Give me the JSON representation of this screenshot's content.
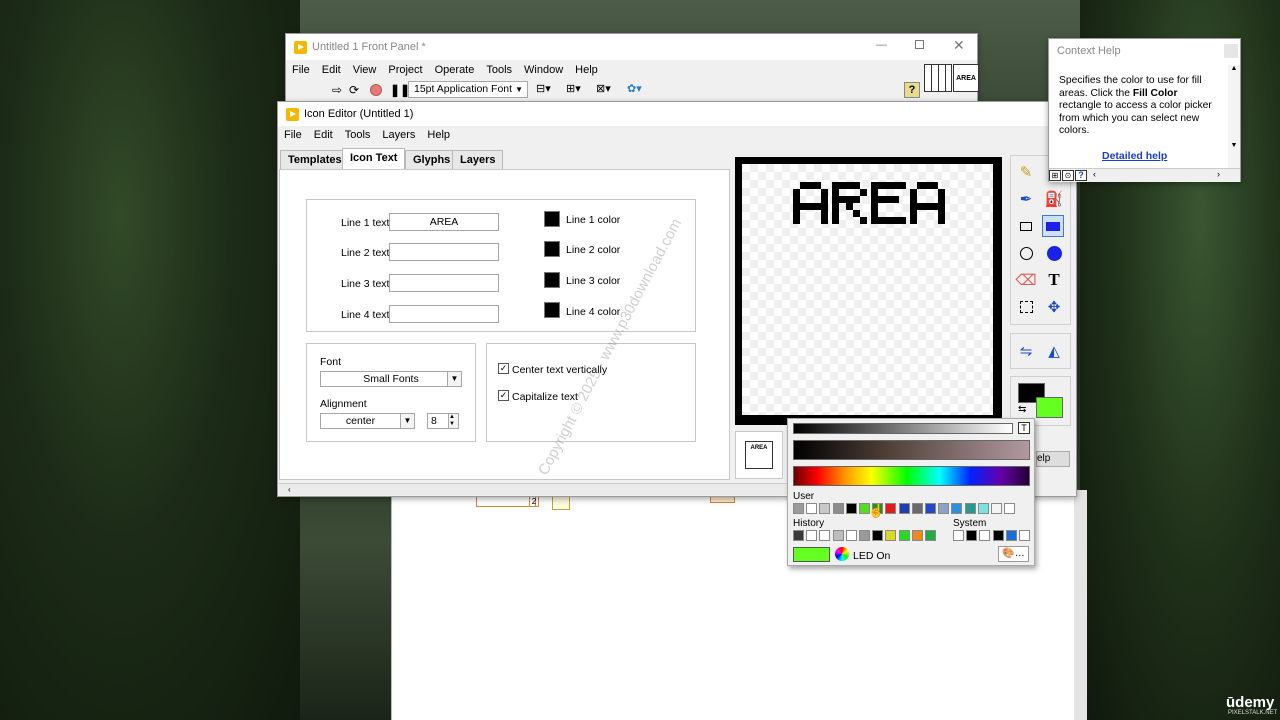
{
  "front_panel": {
    "title": "Untitled 1 Front Panel *",
    "menu": [
      "File",
      "Edit",
      "View",
      "Project",
      "Operate",
      "Tools",
      "Window",
      "Help"
    ],
    "font_select": "15pt Application Font",
    "icon_text": "AREA"
  },
  "icon_editor": {
    "title": "Icon Editor (Untitled 1)",
    "menu": [
      "File",
      "Edit",
      "Tools",
      "Layers",
      "Help"
    ],
    "tabs": [
      "Templates",
      "Icon Text",
      "Glyphs",
      "Layers"
    ],
    "active_tab": "Icon Text",
    "lines": [
      {
        "label": "Line 1 text",
        "value": "AREA",
        "color_label": "Line 1 color"
      },
      {
        "label": "Line 2 text",
        "value": "",
        "color_label": "Line 2 color"
      },
      {
        "label": "Line 3 text",
        "value": "",
        "color_label": "Line 3 color"
      },
      {
        "label": "Line 4 text",
        "value": "",
        "color_label": "Line 4 color"
      }
    ],
    "font_label": "Font",
    "font_value": "Small Fonts",
    "alignment_label": "Alignment",
    "alignment_value": "center",
    "size_value": "8",
    "center_vertically_label": "Center text vertically",
    "center_vertically_checked": true,
    "capitalize_label": "Capitalize text",
    "capitalize_checked": true,
    "preview_small_text": "AREA",
    "canvas_text": "AREA",
    "fill_color": "#66ff22",
    "line_color": "#000000"
  },
  "watermark": "Copyright © 2025 - www.p30download.com",
  "context_help": {
    "title": "Context Help",
    "text_pre": "Specifies the color to use for fill areas. Click the ",
    "text_bold": "Fill Color",
    "text_post": " rectangle to access a color picker from which you can select new colors.",
    "link": "Detailed help"
  },
  "color_picker": {
    "user_label": "User",
    "history_label": "History",
    "system_label": "System",
    "selected_name": "LED On",
    "selected_color": "#66ff22",
    "user_colors": [
      "#9a9a9a",
      "#ffffff",
      "#c8c8c8",
      "#8c8c8c",
      "#000000",
      "#55dd22",
      "#2e8b1e",
      "#e21a1a",
      "#1f3fb0",
      "#6a6a6a",
      "#2348c8",
      "#8fa0c8",
      "#2e8fe0",
      "#26998a",
      "#7ee0e0",
      "#f4f4f4",
      "#ffffff"
    ],
    "history_colors": [
      "#3a3a3a",
      "#ffffff",
      "#ffffff",
      "#bdbdbd",
      "#ffffff",
      "#9a9a9a",
      "#000000",
      "#dada22",
      "#22dd22",
      "#ee8a22",
      "#22aa44"
    ],
    "system_colors": [
      "#ffffff",
      "#000000",
      "#ffffff",
      "#000000",
      "#1a6ed8",
      "#ffffff"
    ]
  },
  "branding": {
    "udemy": "ūdemy",
    "sub": "PIXELSTALK.NET"
  }
}
